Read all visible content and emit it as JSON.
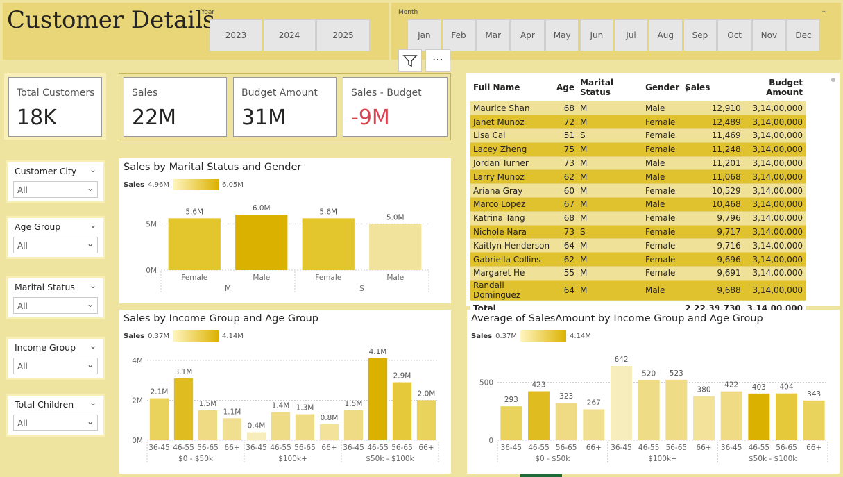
{
  "title": "Customer Details",
  "year_slicer": {
    "label": "Year",
    "options": [
      "2023",
      "2024",
      "2025"
    ]
  },
  "month_slicer": {
    "label": "Month",
    "options": [
      "Jan",
      "Feb",
      "Mar",
      "Apr",
      "May",
      "Jun",
      "Jul",
      "Aug",
      "Sep",
      "Oct",
      "Nov",
      "Dec"
    ]
  },
  "kpis": {
    "total_customers": {
      "label": "Total Customers",
      "value": "18K"
    },
    "sales": {
      "label": "Sales",
      "value": "22M"
    },
    "budget": {
      "label": "Budget Amount",
      "value": "31M"
    },
    "diff": {
      "label": "Sales - Budget",
      "value": "-9M"
    }
  },
  "slicers": [
    {
      "label": "Customer City",
      "value": "All"
    },
    {
      "label": "Age Group",
      "value": "All"
    },
    {
      "label": "Marital Status",
      "value": "All"
    },
    {
      "label": "Income Group",
      "value": "All"
    },
    {
      "label": "Total Children",
      "value": "All"
    }
  ],
  "table": {
    "headers": [
      "Full Name",
      "Age",
      "Marital Status",
      "Gender",
      "Sales",
      "Budget Amount"
    ],
    "rows": [
      [
        "Maurice Shan",
        "68",
        "M",
        "Male",
        "12,910",
        "3,14,00,000"
      ],
      [
        "Janet Munoz",
        "72",
        "M",
        "Female",
        "12,489",
        "3,14,00,000"
      ],
      [
        "Lisa Cai",
        "51",
        "S",
        "Female",
        "11,469",
        "3,14,00,000"
      ],
      [
        "Lacey Zheng",
        "75",
        "M",
        "Female",
        "11,248",
        "3,14,00,000"
      ],
      [
        "Jordan Turner",
        "73",
        "M",
        "Male",
        "11,201",
        "3,14,00,000"
      ],
      [
        "Larry Munoz",
        "62",
        "M",
        "Male",
        "11,068",
        "3,14,00,000"
      ],
      [
        "Ariana Gray",
        "60",
        "M",
        "Female",
        "10,529",
        "3,14,00,000"
      ],
      [
        "Marco Lopez",
        "67",
        "M",
        "Male",
        "10,468",
        "3,14,00,000"
      ],
      [
        "Katrina Tang",
        "68",
        "M",
        "Female",
        "9,796",
        "3,14,00,000"
      ],
      [
        "Nichole Nara",
        "73",
        "S",
        "Female",
        "9,717",
        "3,14,00,000"
      ],
      [
        "Kaitlyn Henderson",
        "64",
        "M",
        "Female",
        "9,716",
        "3,14,00,000"
      ],
      [
        "Gabriella Collins",
        "62",
        "M",
        "Female",
        "9,696",
        "3,14,00,000"
      ],
      [
        "Margaret He",
        "55",
        "M",
        "Female",
        "9,691",
        "3,14,00,000"
      ],
      [
        "Randall Dominguez",
        "64",
        "M",
        "Male",
        "9,688",
        "3,14,00,000"
      ]
    ],
    "total": [
      "Total",
      "",
      "",
      "",
      "2,22,39,730",
      "3,14,00,000"
    ]
  },
  "chart_data": [
    {
      "type": "bar",
      "title": "Sales by Marital Status and Gender",
      "legend": {
        "label": "Sales",
        "min": "4.96M",
        "max": "6.05M"
      },
      "yticks": [
        "0M",
        "5M"
      ],
      "groups": [
        "M",
        "S"
      ],
      "categories": [
        "Female",
        "Male",
        "Female",
        "Male"
      ],
      "values": [
        5.6,
        6.0,
        5.6,
        5.0
      ],
      "labels": [
        "5.6M",
        "6.0M",
        "5.6M",
        "5.0M"
      ],
      "colors": [
        "#e3c62e",
        "#dbb100",
        "#e3c62e",
        "#f1e39b"
      ],
      "ylim": [
        0,
        6.0
      ]
    },
    {
      "type": "bar",
      "title": "Sales by Income Group and Age Group",
      "legend": {
        "label": "Sales",
        "min": "0.37M",
        "max": "4.14M"
      },
      "yticks": [
        "0M",
        "2M",
        "4M"
      ],
      "groups": [
        "$0 - $50k",
        "$100k+",
        "$50k - $100k"
      ],
      "categories": [
        "36-45",
        "46-55",
        "56-65",
        "66+",
        "36-45",
        "46-55",
        "56-65",
        "66+",
        "36-45",
        "46-55",
        "56-65",
        "66+"
      ],
      "values": [
        2.1,
        3.1,
        1.5,
        1.1,
        0.4,
        1.4,
        1.3,
        0.8,
        1.5,
        4.1,
        2.9,
        2.0
      ],
      "labels": [
        "2.1M",
        "3.1M",
        "1.5M",
        "1.1M",
        "0.4M",
        "1.4M",
        "1.3M",
        "0.8M",
        "1.5M",
        "4.1M",
        "2.9M",
        "2.0M"
      ],
      "colors": [
        "#e9d35c",
        "#dfbd20",
        "#eedb84",
        "#f0df8e",
        "#f7edbc",
        "#efdc86",
        "#efdc86",
        "#f2e29a",
        "#eedb84",
        "#dbb100",
        "#e5c93a",
        "#e9d35c"
      ],
      "ylim": [
        0,
        4.1
      ]
    },
    {
      "type": "bar",
      "title": "Average of SalesAmount by Income Group and Age Group",
      "legend": {
        "label": "Sales",
        "min": "0.37M",
        "max": "4.14M"
      },
      "yticks": [
        "0",
        "500"
      ],
      "groups": [
        "$0 - $50k",
        "$100k+",
        "$50k - $100k"
      ],
      "categories": [
        "36-45",
        "46-55",
        "56-65",
        "66+",
        "36-45",
        "46-55",
        "56-65",
        "66+",
        "36-45",
        "46-55",
        "56-65",
        "66+"
      ],
      "values": [
        293,
        423,
        323,
        267,
        642,
        520,
        523,
        380,
        422,
        403,
        404,
        343
      ],
      "labels": [
        "293",
        "423",
        "323",
        "267",
        "642",
        "520",
        "523",
        "380",
        "422",
        "403",
        "404",
        "343"
      ],
      "colors": [
        "#e9d35c",
        "#dfbd20",
        "#eedb84",
        "#f0df8e",
        "#f7edbc",
        "#efdc86",
        "#efdc86",
        "#f2e29a",
        "#eedb84",
        "#dbb100",
        "#e5c93a",
        "#e9d35c"
      ],
      "ylim": [
        0,
        642
      ]
    }
  ]
}
